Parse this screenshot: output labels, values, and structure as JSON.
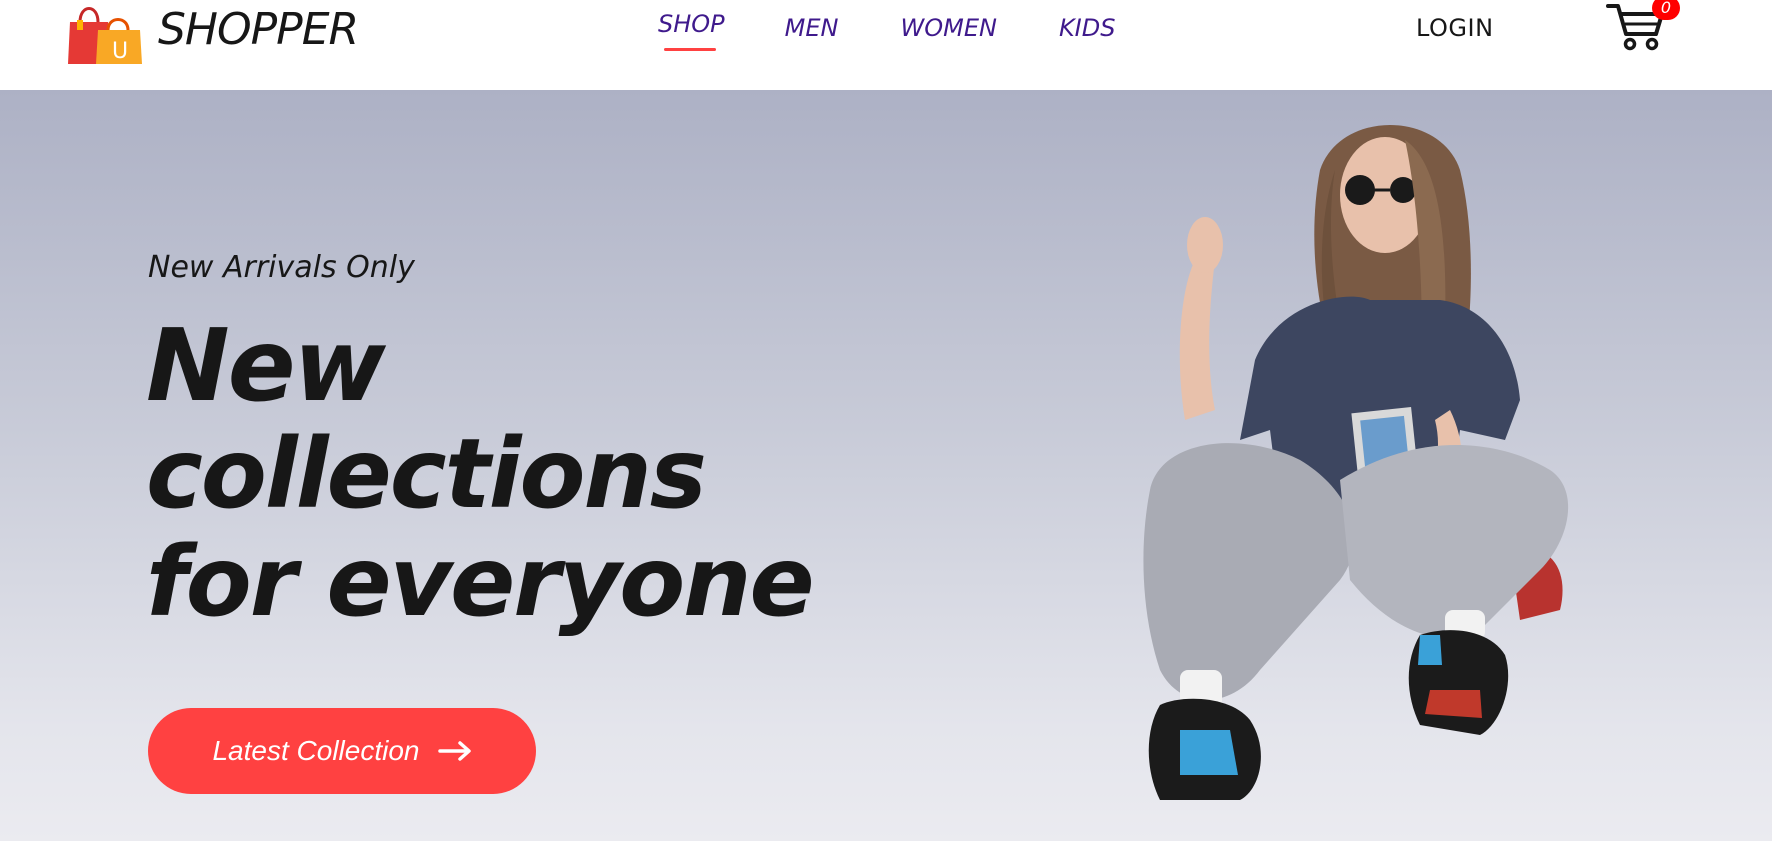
{
  "navbar": {
    "brand": "SHOPPER",
    "menu": [
      {
        "label": "SHOP",
        "active": true
      },
      {
        "label": "MEN",
        "active": false
      },
      {
        "label": "WOMEN",
        "active": false
      },
      {
        "label": "KIDS",
        "active": false
      }
    ],
    "login_label": "LOGIN",
    "cart_count": "0",
    "icons": {
      "logo": "shopping-bags-icon",
      "cart": "shopping-cart-icon"
    }
  },
  "hero": {
    "subtitle": "New Arrivals Only",
    "title_lines": [
      "New",
      "collections",
      "for everyone"
    ],
    "cta_label": "Latest Collection",
    "cta_icon": "arrow-right-icon",
    "image_alt": "hero-model"
  },
  "colors": {
    "accent": "#ff4141",
    "nav_text": "#3f1a8c",
    "hero_gradient_top": "#adb1c5",
    "hero_gradient_bottom": "#ebebf0",
    "cart_badge": "#ff0000"
  }
}
